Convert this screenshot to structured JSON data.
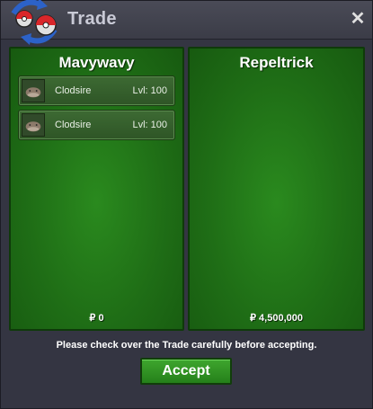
{
  "window": {
    "title": "Trade",
    "close_label": "✕"
  },
  "left_panel": {
    "player": "Mavywavy",
    "pokemon": [
      {
        "name": "Clodsire",
        "level": "Lvl: 100"
      },
      {
        "name": "Clodsire",
        "level": "Lvl: 100"
      }
    ],
    "money": "₽ 0"
  },
  "right_panel": {
    "player": "Repeltrick",
    "pokemon": [],
    "money": "₽ 4,500,000"
  },
  "notice": "Please check over the Trade carefully before accepting.",
  "accept_label": "Accept",
  "icons": {
    "logo": "pokeball-swap-icon",
    "close": "close-icon",
    "pokemon": "clodsire-icon"
  },
  "colors": {
    "panel_green": "#1f6e16",
    "accept_green": "#2f9222",
    "window_bg": "#343542"
  }
}
